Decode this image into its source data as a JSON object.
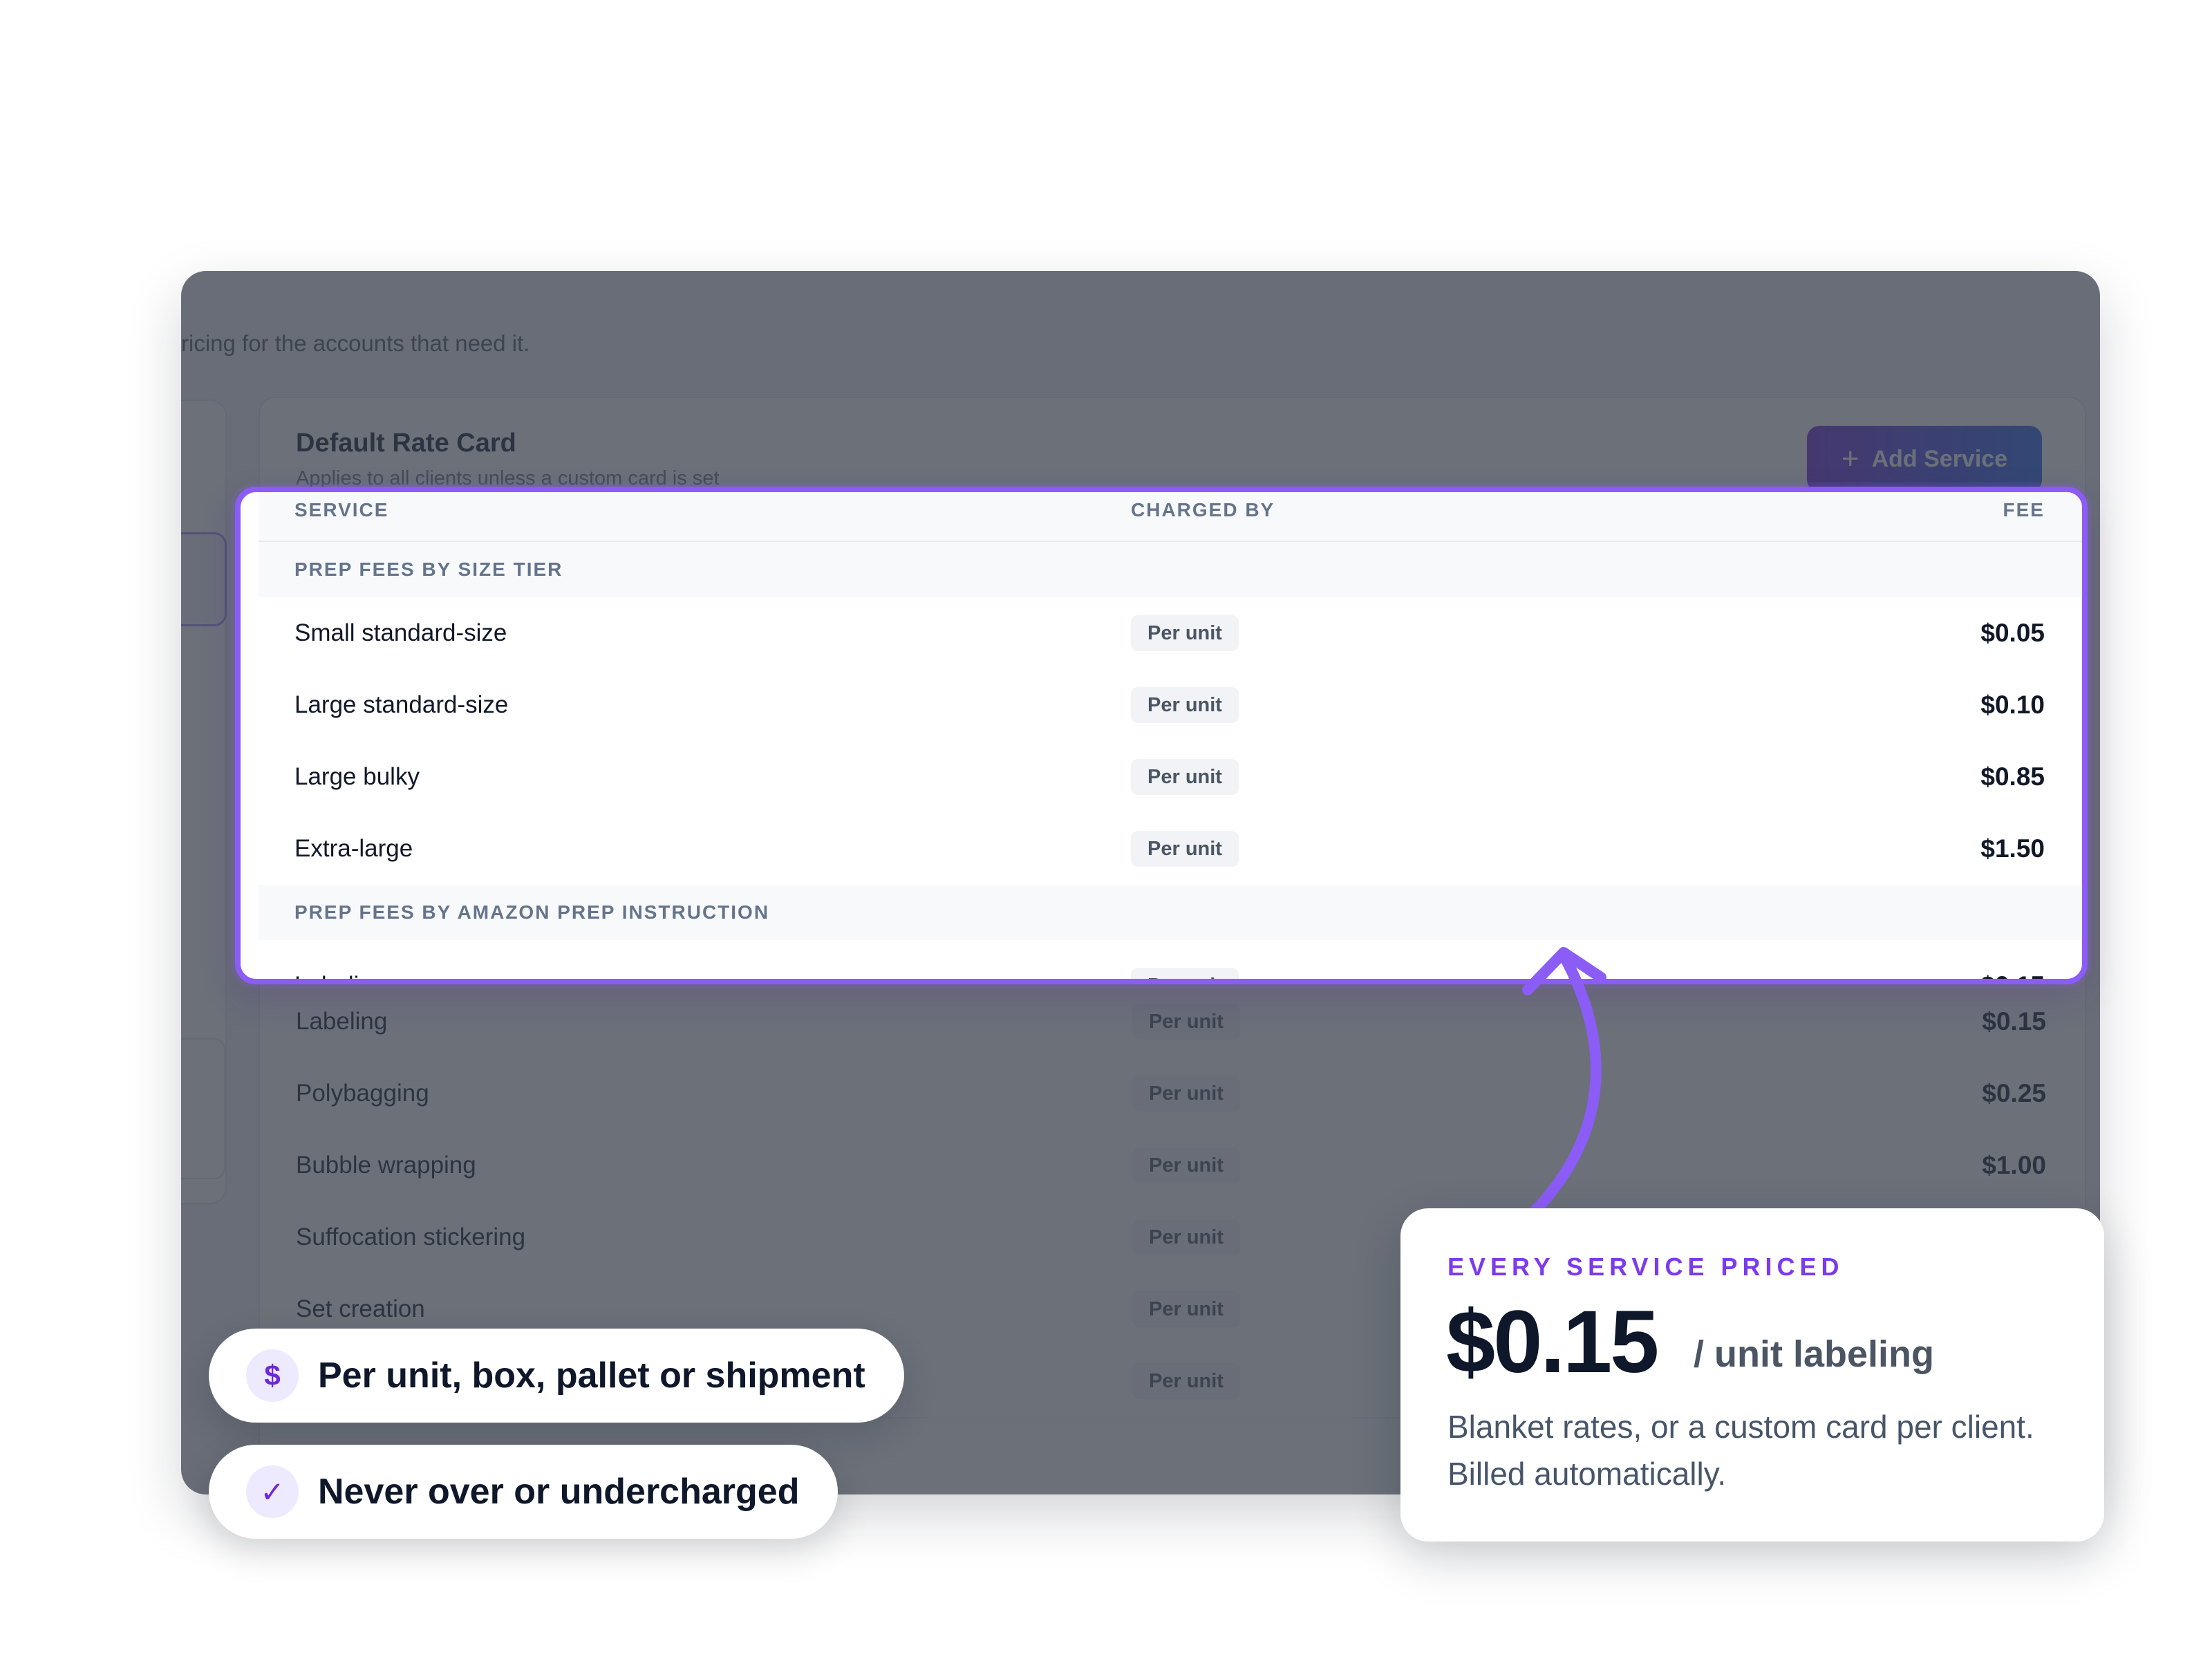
{
  "intro_text": "ricing for the accounts that need it.",
  "rate_card": {
    "title": "Default Rate Card",
    "subtitle": "Applies to all clients unless a custom card is set",
    "add_button": "Add Service",
    "columns": {
      "service": "SERVICE",
      "charged_by": "CHARGED BY",
      "fee": "FEE"
    },
    "groups": [
      {
        "label": "PREP FEES BY SIZE TIER",
        "rows": [
          {
            "service": "Small standard-size",
            "charged_by": "Per unit",
            "fee": "$0.05"
          },
          {
            "service": "Large standard-size",
            "charged_by": "Per unit",
            "fee": "$0.10"
          },
          {
            "service": "Large bulky",
            "charged_by": "Per unit",
            "fee": "$0.85"
          },
          {
            "service": "Extra-large",
            "charged_by": "Per unit",
            "fee": "$1.50"
          }
        ]
      },
      {
        "label": "PREP FEES BY AMAZON PREP INSTRUCTION",
        "rows": [
          {
            "service": "Labeling",
            "charged_by": "Per unit",
            "fee": "$0.15"
          },
          {
            "service": "Polybagging",
            "charged_by": "Per unit",
            "fee": "$0.25"
          },
          {
            "service": "Bubble wrapping",
            "charged_by": "Per unit",
            "fee": "$1.00"
          },
          {
            "service": "Suffocation stickering",
            "charged_by": "Per unit",
            "fee": ""
          },
          {
            "service": "Set creation",
            "charged_by": "Per unit",
            "fee": ""
          },
          {
            "service": "",
            "charged_by": "Per unit",
            "fee": ""
          }
        ]
      }
    ]
  },
  "callout": {
    "eyebrow": "EVERY SERVICE PRICED",
    "price": "$0.15",
    "unit": "/ unit labeling",
    "description": "Blanket rates, or a custom card per client. Billed automatically."
  },
  "pills": [
    {
      "icon": "dollar-icon",
      "glyph": "$",
      "text": "Per unit, box, pallet or shipment"
    },
    {
      "icon": "check-icon",
      "glyph": "✓",
      "text": "Never over or undercharged"
    }
  ],
  "colors": {
    "accent": "#8b5cf6",
    "button_start": "#6d28d9",
    "button_end": "#2563eb"
  }
}
